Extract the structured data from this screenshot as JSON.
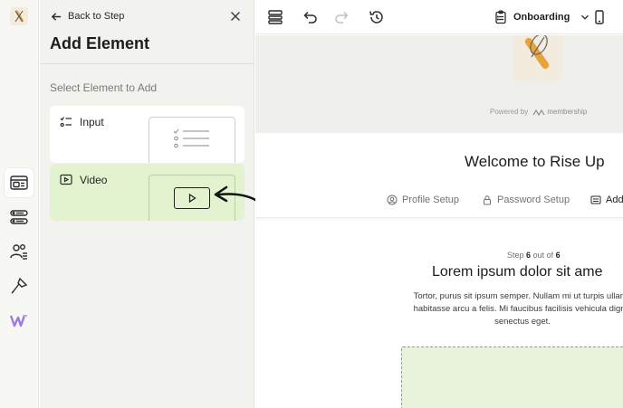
{
  "panel": {
    "back_label": "Back to Step",
    "title": "Add Element",
    "subtitle": "Select Element to Add",
    "elements": [
      {
        "label": "Input",
        "icon": "checklist-icon"
      },
      {
        "label": "Video",
        "icon": "video-play-icon"
      }
    ]
  },
  "rail": {
    "logo_icon": "whisk-logo-icon",
    "items": [
      "steps-icon",
      "fields-icon",
      "members-icon",
      "design-brush-icon",
      "webflow-icon"
    ]
  },
  "toolbar": {
    "flow_name": "Onboarding"
  },
  "canvas": {
    "powered_by": "Powered by",
    "brand": "membership",
    "welcome": "Welcome to Rise Up",
    "tabs": [
      {
        "label": "Profile Setup",
        "icon": "user-circle-icon"
      },
      {
        "label": "Password Setup",
        "icon": "lock-icon"
      },
      {
        "label": "Add",
        "icon": "card-icon"
      }
    ],
    "step_prefix": "Step",
    "step_current": "6",
    "step_mid": "out of",
    "step_total": "6",
    "heading": "Lorem ipsum dolor sit ame",
    "body_lines": [
      "Tortor, purus sit ipsum semper. Nullam mi ut turpis ullamc",
      "habitasse arcu a felis. Mi faucibus facilisis vehicula dignis",
      "senectus eget."
    ]
  },
  "colors": {
    "accent_green_bg": "#e4f3cf",
    "dashed_green": "#7bb34f",
    "logo_orange": "#e8a33a"
  }
}
